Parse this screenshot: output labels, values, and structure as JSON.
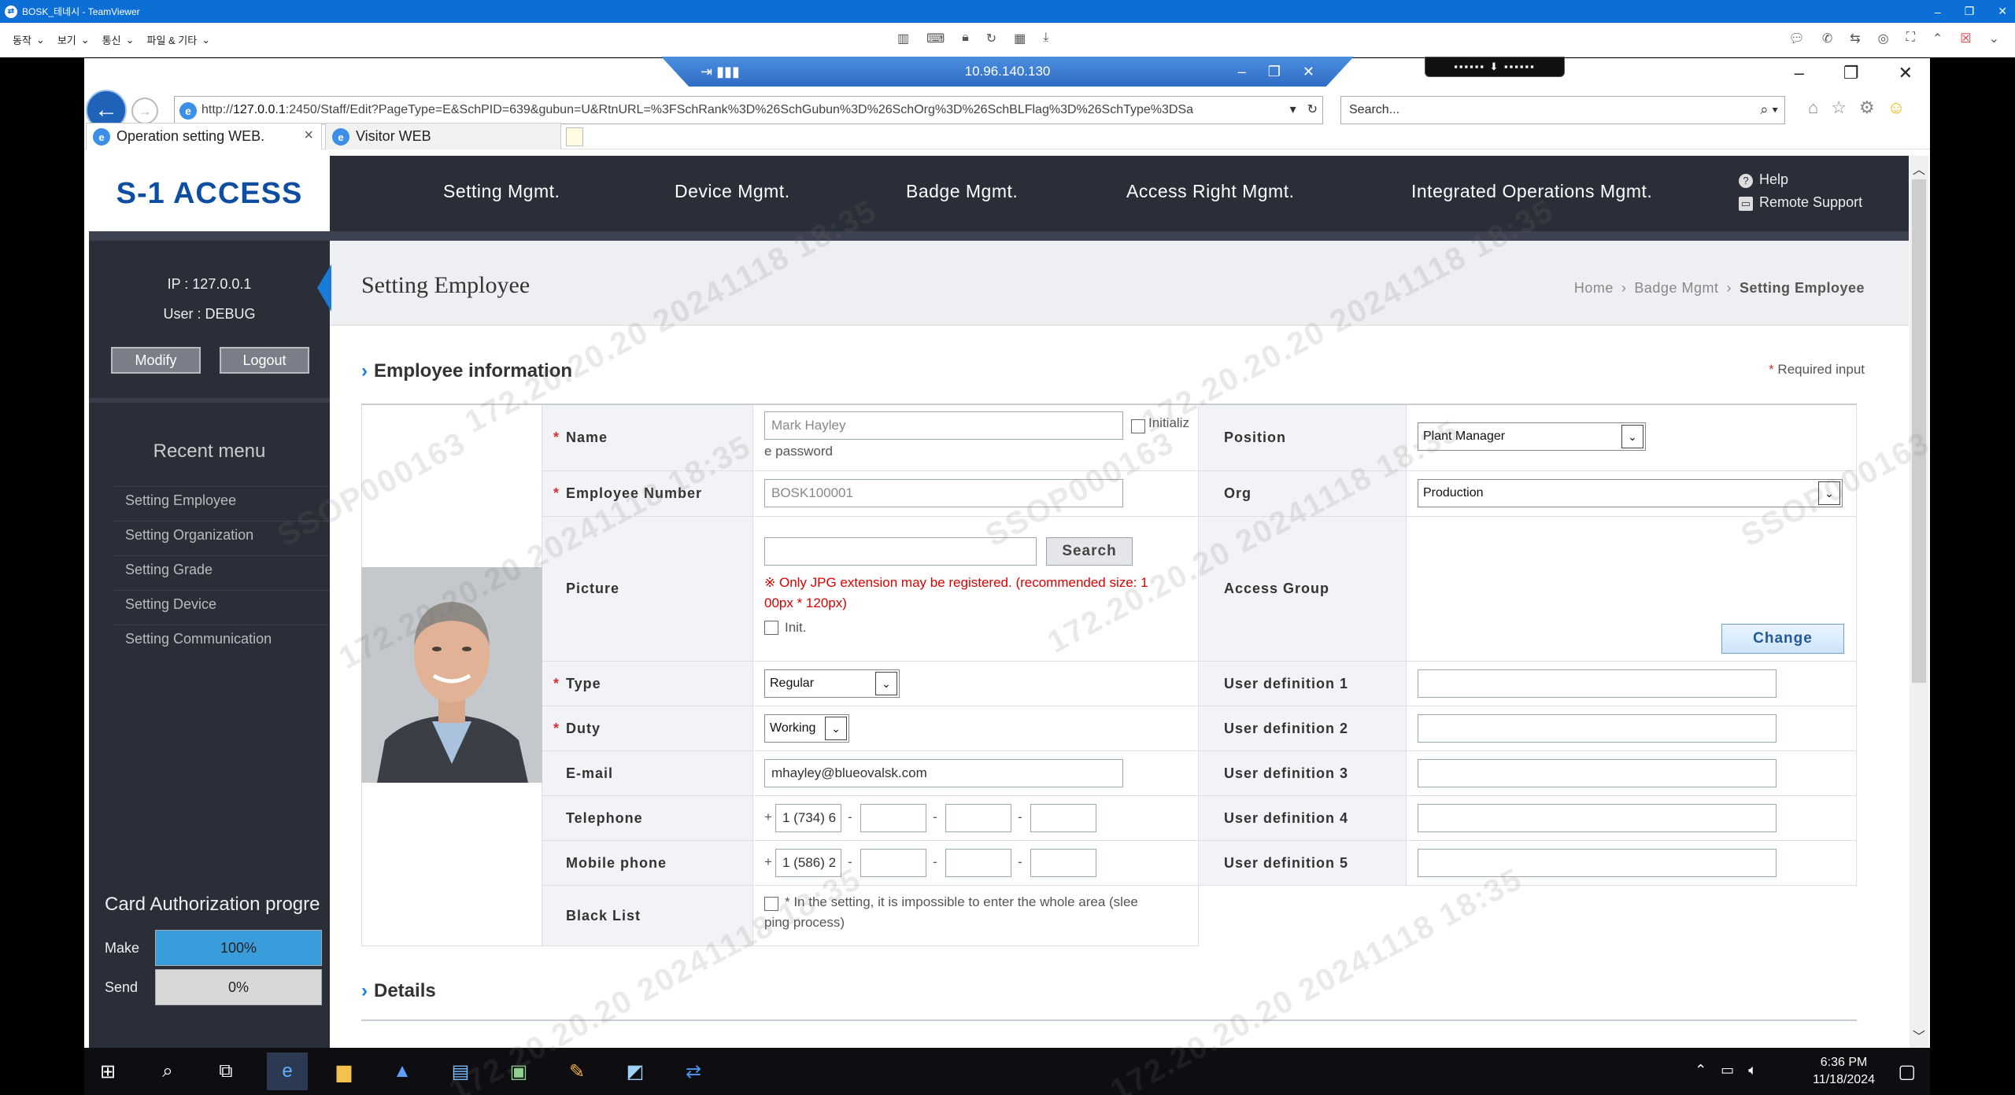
{
  "teamviewer": {
    "title": "BOSK_테네시 - TeamViewer",
    "menu": [
      "동작",
      "보기",
      "통신",
      "파일 & 기타"
    ],
    "connection_ip": "10.96.140.130"
  },
  "browser": {
    "url_prefix": "http://",
    "url_host": "127.0.0.1",
    "url_rest": ":2450/Staff/Edit?PageType=E&SchPID=639&gubun=U&RtnURL=%3FSchRank%3D%26SchGubun%3D%26SchOrg%3D%26SchBLFlag%3D%26SchType%3DSa",
    "search_placeholder": "Search...",
    "tabs": [
      {
        "label": "Operation setting WEB.",
        "active": true
      },
      {
        "label": "Visitor WEB",
        "active": false
      }
    ]
  },
  "app": {
    "logo": "S-1 ACCESS",
    "nav": [
      "Setting Mgmt.",
      "Device Mgmt.",
      "Badge Mgmt.",
      "Access Right Mgmt.",
      "Integrated Operations Mgmt."
    ],
    "help": "Help",
    "remote_support": "Remote Support"
  },
  "sidebar": {
    "ip": "IP : 127.0.0.1",
    "user": "User : DEBUG",
    "modify": "Modify",
    "logout": "Logout",
    "recent_title": "Recent menu",
    "recent": [
      "Setting Employee",
      "Setting Organization",
      "Setting Grade",
      "Setting Device",
      "Setting Communication"
    ],
    "card_title": "Card Authorization progre",
    "make_label": "Make",
    "make_value": "100%",
    "make_fraction": 1.0,
    "send_label": "Send",
    "send_value": "0%",
    "send_fraction": 0.0
  },
  "page": {
    "title": "Setting Employee",
    "breadcrumb": [
      "Home",
      "Badge Mgmt",
      "Setting Employee"
    ],
    "section_employee": "Employee information",
    "required_note": "Required input",
    "section_details": "Details"
  },
  "form": {
    "name_label": "Name",
    "name_value": "Mark Hayley",
    "init_password": "Initializ",
    "init_password_wrap": "e password",
    "employee_number_label": "Employee Number",
    "employee_number_value": "BOSK100001",
    "picture_label": "Picture",
    "search_button": "Search",
    "picture_warning": "※ Only JPG extension may be registered. (recommended size: 1",
    "picture_warning_wrap": "00px * 120px)",
    "picture_init": "Init.",
    "type_label": "Type",
    "type_value": "Regular",
    "duty_label": "Duty",
    "duty_value": "Working",
    "email_label": "E-mail",
    "email_value": "mhayley@blueovalsk.com",
    "telephone_label": "Telephone",
    "telephone_value": "1 (734) 6",
    "mobile_label": "Mobile phone",
    "mobile_value": "1 (586) 2",
    "plus": "+",
    "dash": "-",
    "blacklist_label": "Black List",
    "blacklist_note": "* In the setting, it is impossible to enter the whole area (slee",
    "blacklist_note_wrap": "ping process)",
    "position_label": "Position",
    "position_value": "Plant Manager",
    "org_label": "Org",
    "org_value": "Production",
    "access_group_label": "Access Group",
    "change_button": "Change",
    "user_def_labels": [
      "User definition 1",
      "User definition 2",
      "User definition 3",
      "User definition 4",
      "User definition 5"
    ]
  },
  "taskbar": {
    "time": "6:36 PM",
    "date": "11/18/2024"
  },
  "watermarks": [
    "172.20.20.20 20241118 18:35",
    "SSOP000163"
  ]
}
